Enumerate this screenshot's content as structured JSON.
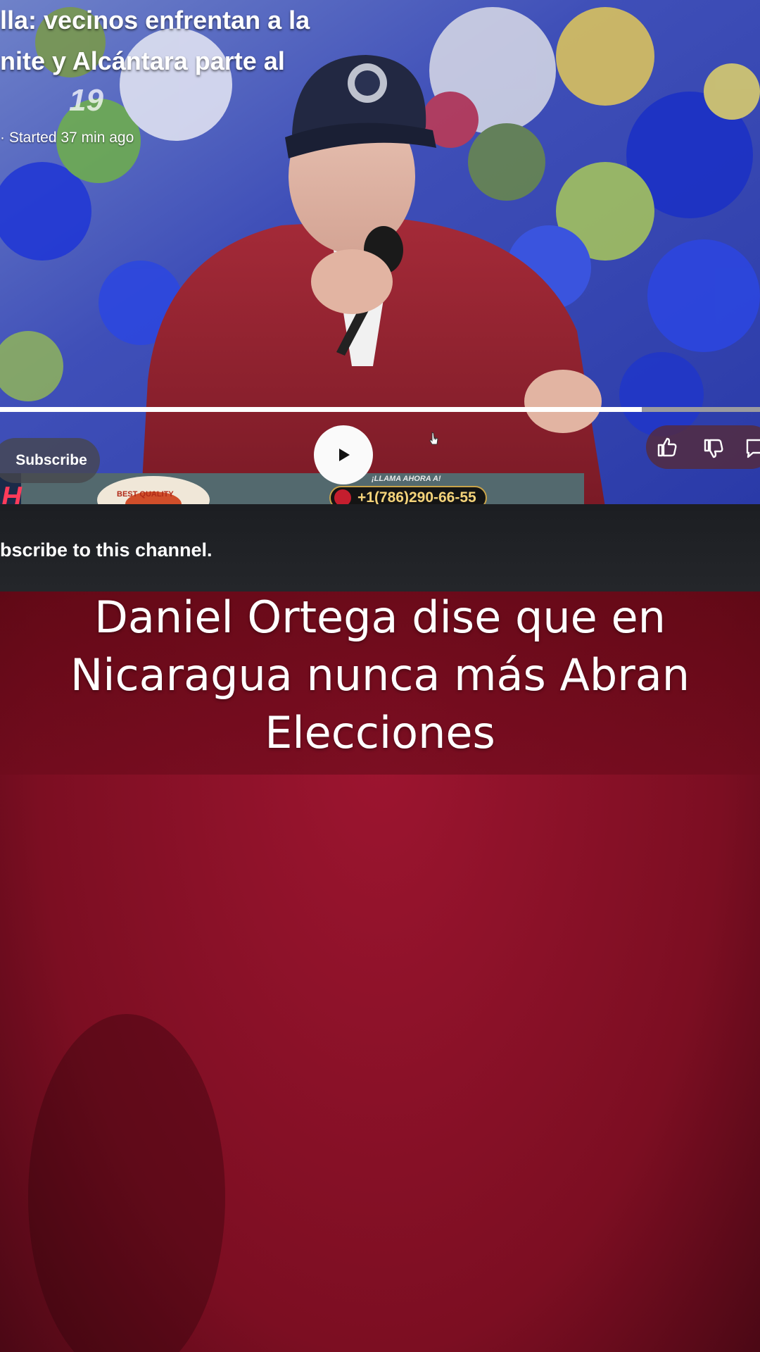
{
  "video": {
    "title_line1": "lla: vecinos enfrentan a la",
    "title_line2": "nite y Alcántara parte al",
    "overlay_number": "19",
    "started": "· Started 37 min ago"
  },
  "player": {
    "subscribe_label": "Subscribe",
    "phone_header": "¡LLAMA AHORA A!",
    "phone_number": "+1(786)290-66-55",
    "sponsor_logo_text": "BEST QUALITY",
    "edge_text": "H"
  },
  "channel_bar": {
    "subscribe_prompt": "bscribe to this channel."
  },
  "caption": {
    "line1": "Daniel Ortega dise que en",
    "line2": "Nicaragua nunca más Abran",
    "line3": "Elecciones"
  },
  "icons": [
    "play-icon",
    "thumbs-up-icon",
    "thumbs-down-icon",
    "comment-icon",
    "cursor-icon",
    "phone-icon"
  ],
  "colors": {
    "fabric": "#8a1226",
    "jacket": "#8c1f2c",
    "cap": "#22283f",
    "phone_gold": "#c8a34a"
  }
}
